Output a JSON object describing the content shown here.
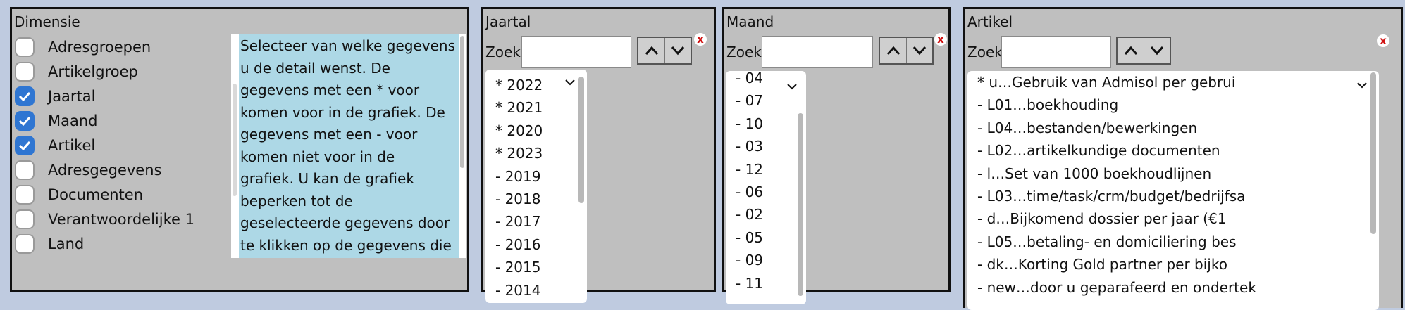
{
  "dimensie": {
    "title": "Dimensie",
    "items": [
      {
        "label": "Adresgroepen",
        "checked": false
      },
      {
        "label": "Artikelgroep",
        "checked": false
      },
      {
        "label": "Jaartal",
        "checked": true
      },
      {
        "label": "Maand",
        "checked": true
      },
      {
        "label": "Artikel",
        "checked": true
      },
      {
        "label": "Adresgegevens",
        "checked": false
      },
      {
        "label": "Documenten",
        "checked": false
      },
      {
        "label": "Verantwoordelijke 1",
        "checked": false
      },
      {
        "label": "Land",
        "checked": false
      }
    ],
    "info": "Selecteer van welke gegevens\nu de detail wenst. De\ngegevens met een * voor\nkomen voor in de grafiek. De\ngegevens met een - voor\nkomen niet voor in de\ngrafiek. U kan de grafiek\nbeperken tot de\ngeselecteerde gegevens door\nte klikken op de gegevens die"
  },
  "jaartal": {
    "title": "Jaartal",
    "search_label": "Zoek",
    "search_value": "",
    "close": "x",
    "items": [
      "* 2022",
      "* 2021",
      "* 2020",
      "* 2023",
      "- 2019",
      "- 2018",
      "- 2017",
      "- 2016",
      "- 2015",
      "- 2014"
    ]
  },
  "maand": {
    "title": "Maand",
    "search_label": "Zoek",
    "search_value": "",
    "close": "x",
    "items": [
      "- 04",
      "- 07",
      "- 10",
      "- 03",
      "- 12",
      "- 06",
      "- 02",
      "- 05",
      "- 09",
      "- 11"
    ]
  },
  "artikel": {
    "title": "Artikel",
    "search_label": "Zoek",
    "search_value": "",
    "close": "x",
    "items": [
      "* u…Gebruik van Admisol per gebrui",
      "- L01…boekhouding",
      "- L04…bestanden/bewerkingen",
      "- L02…artikelkundige documenten",
      "- l…Set van 1000 boekhoudlijnen",
      "- L03…time/task/crm/budget/bedrijfsa",
      "- d…Bijkomend dossier per jaar (€1",
      "- L05…betaling- en domiciliering bes",
      "- dk…Korting Gold partner per bijko",
      "- new…door u geparafeerd en ondertek"
    ]
  },
  "colors": {
    "checkbox_checked": "#2f76d2",
    "info_bg": "#add8e6",
    "panel_bg": "#bfbfbf",
    "close": "#d01010"
  }
}
